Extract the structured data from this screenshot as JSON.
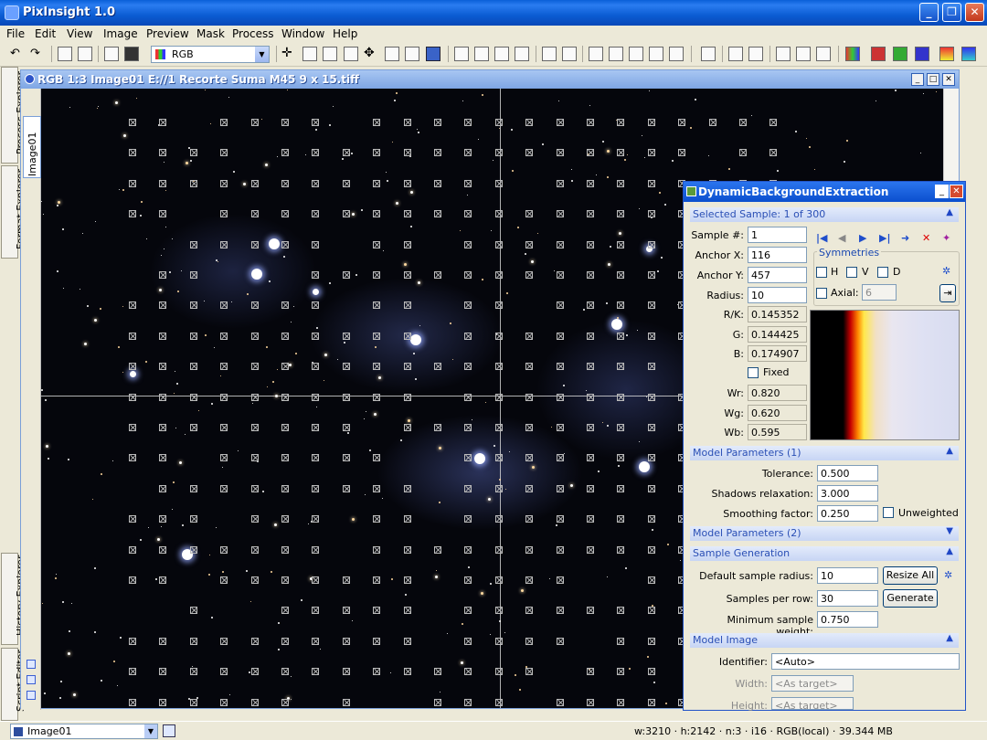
{
  "app": {
    "title": "PixInsight 1.0"
  },
  "menu": [
    "File",
    "Edit",
    "View",
    "Image",
    "Preview",
    "Mask",
    "Process",
    "Window",
    "Help"
  ],
  "toolbar": {
    "color_space": "RGB"
  },
  "left_tabs": [
    "Process Explorer",
    "Format Explorer",
    "History Explorer",
    "Script Editor"
  ],
  "image_window": {
    "title": "RGB 1:3 Image01 E://1 Recorte Suma M45 9 x 15.tiff",
    "side_label": "Image01"
  },
  "dbe": {
    "title": "DynamicBackgroundExtraction",
    "selected_sample_header": "Selected Sample: 1 of 300",
    "sample_no_label": "Sample #:",
    "sample_no": "1",
    "anchor_x_label": "Anchor X:",
    "anchor_x": "116",
    "anchor_y_label": "Anchor Y:",
    "anchor_y": "457",
    "radius_label": "Radius:",
    "radius": "10",
    "rk_label": "R/K:",
    "rk": "0.145352",
    "g_label": "G:",
    "g": "0.144425",
    "b_label": "B:",
    "b": "0.174907",
    "fixed_label": "Fixed",
    "wr_label": "Wr:",
    "wr": "0.820",
    "wg_label": "Wg:",
    "wg": "0.620",
    "wb_label": "Wb:",
    "wb": "0.595",
    "symmetries_label": "Symmetries",
    "sym_h": "H",
    "sym_v": "V",
    "sym_d": "D",
    "axial_label": "Axial:",
    "axial_value": "6",
    "model_params_1": "Model Parameters (1)",
    "tolerance_label": "Tolerance:",
    "tolerance": "0.500",
    "shadows_label": "Shadows relaxation:",
    "shadows": "3.000",
    "smoothing_label": "Smoothing factor:",
    "smoothing": "0.250",
    "unweighted_label": "Unweighted",
    "model_params_2": "Model Parameters (2)",
    "sample_generation": "Sample Generation",
    "default_radius_label": "Default sample radius:",
    "default_radius": "10",
    "resize_all": "Resize All",
    "samples_per_row_label": "Samples per row:",
    "samples_per_row": "30",
    "generate": "Generate",
    "min_weight_label": "Minimum sample weight:",
    "min_weight": "0.750",
    "model_image": "Model Image",
    "identifier_label": "Identifier:",
    "identifier": "<Auto>",
    "width_label": "Width:",
    "width": "<As target>",
    "height_label": "Height:",
    "height": "<As target>"
  },
  "status": {
    "view": "Image01",
    "info": "w:3210 · h:2142 · n:3 · i16 · RGB(local) · 39.344 MB"
  }
}
